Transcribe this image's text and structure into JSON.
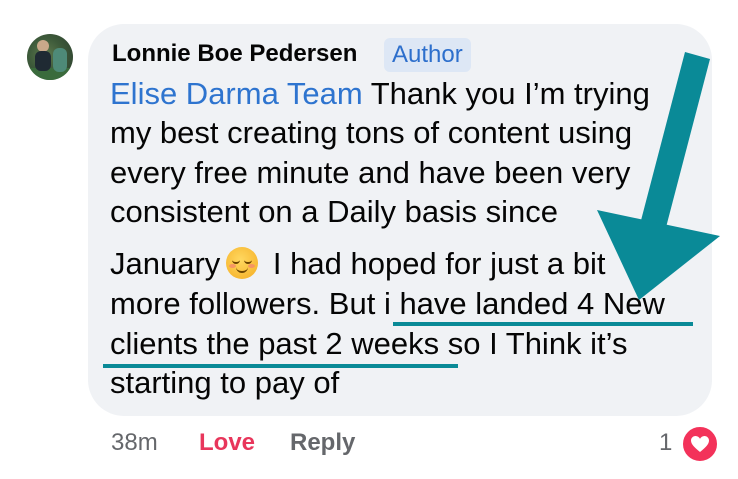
{
  "comment": {
    "author": "Lonnie Boe Pedersen",
    "badge": "Author",
    "mention": "Elise Darma Team",
    "lines": [
      " Thank you I’m trying",
      "my best creating tons of content using",
      "every free minute and have been very",
      "consistent on a Daily basis since",
      "January",
      " I had hoped for just a bit",
      "more followers. But ",
      "i have landed 4 New",
      "clients the past 2 weeks",
      " so I Think it’s",
      "starting to pay of"
    ],
    "emoji": "smiling-face-icon"
  },
  "actions": {
    "time": "38m",
    "love": "Love",
    "reply": "Reply",
    "reaction_count": "1"
  },
  "colors": {
    "bubble": "#f0f2f5",
    "mention": "#2e74cf",
    "love": "#e8365b",
    "annotation": "#0a8a97"
  }
}
